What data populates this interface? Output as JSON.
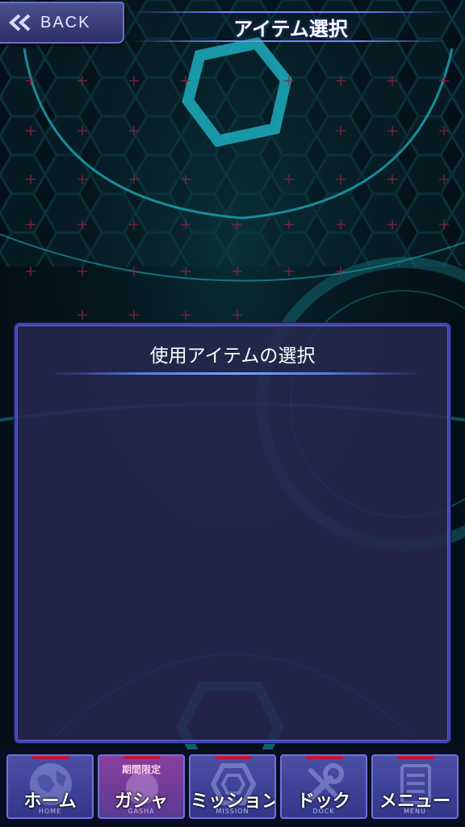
{
  "header": {
    "back_label": "BACK",
    "title": "アイテム選択"
  },
  "panel": {
    "title": "使用アイテムの選択"
  },
  "nav": {
    "items": [
      {
        "label": "ホーム",
        "sub": "HOME",
        "icon": "globe-icon"
      },
      {
        "label": "ガシャ",
        "sub": "GASHA",
        "badge": "期間限定",
        "icon": "gasha-icon"
      },
      {
        "label": "ミッション",
        "sub": "MISSION",
        "icon": "mission-icon"
      },
      {
        "label": "ドック",
        "sub": "DOCK",
        "icon": "wrench-icon"
      },
      {
        "label": "メニュー",
        "sub": "MENU",
        "icon": "menu-icon"
      }
    ]
  },
  "colors": {
    "background": "#06141c",
    "hex_grid": "#0f6a78",
    "accent_cyan": "#20c8d8",
    "panel_border": "#4046b0",
    "nav_button": "#4b4fa6",
    "gasha_button": "#8a3f9e",
    "red_marker": "#c5143a"
  }
}
